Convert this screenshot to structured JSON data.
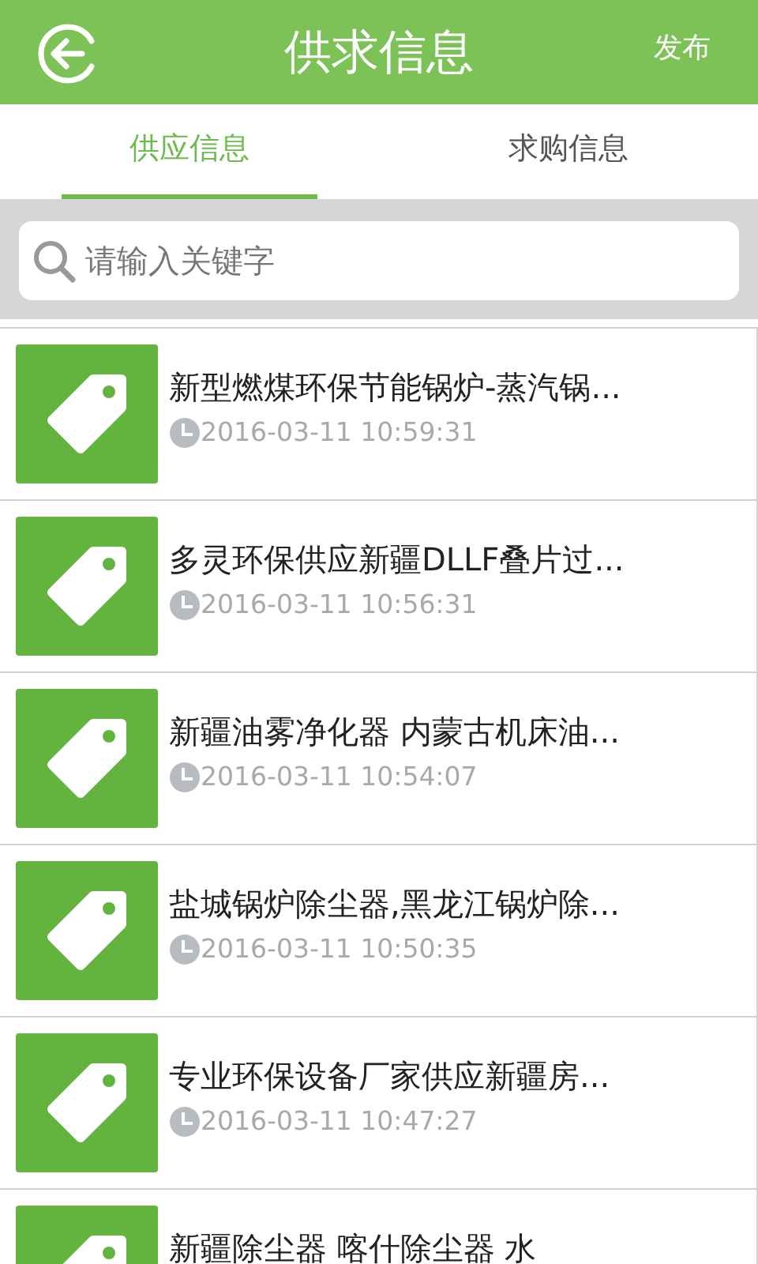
{
  "header": {
    "title": "供求信息",
    "action": "发布"
  },
  "tabs": [
    {
      "label": "供应信息",
      "selected": true
    },
    {
      "label": "求购信息",
      "selected": false
    }
  ],
  "search": {
    "placeholder": "请输入关键字"
  },
  "items": [
    {
      "title": "新型燃煤环保节能锅炉-蒸汽锅...",
      "time": "2016-03-11 10:59:31"
    },
    {
      "title": "多灵环保供应新疆DLLF叠片过...",
      "time": "2016-03-11 10:56:31"
    },
    {
      "title": "新疆油雾净化器 内蒙古机床油...",
      "time": "2016-03-11 10:54:07"
    },
    {
      "title": "盐城锅炉除尘器,黑龙江锅炉除...",
      "time": "2016-03-11 10:50:35"
    },
    {
      "title": "专业环保设备厂家供应新疆房...",
      "time": "2016-03-11 10:47:27"
    },
    {
      "title": "新疆除尘器 喀什除尘器 水"
    }
  ]
}
